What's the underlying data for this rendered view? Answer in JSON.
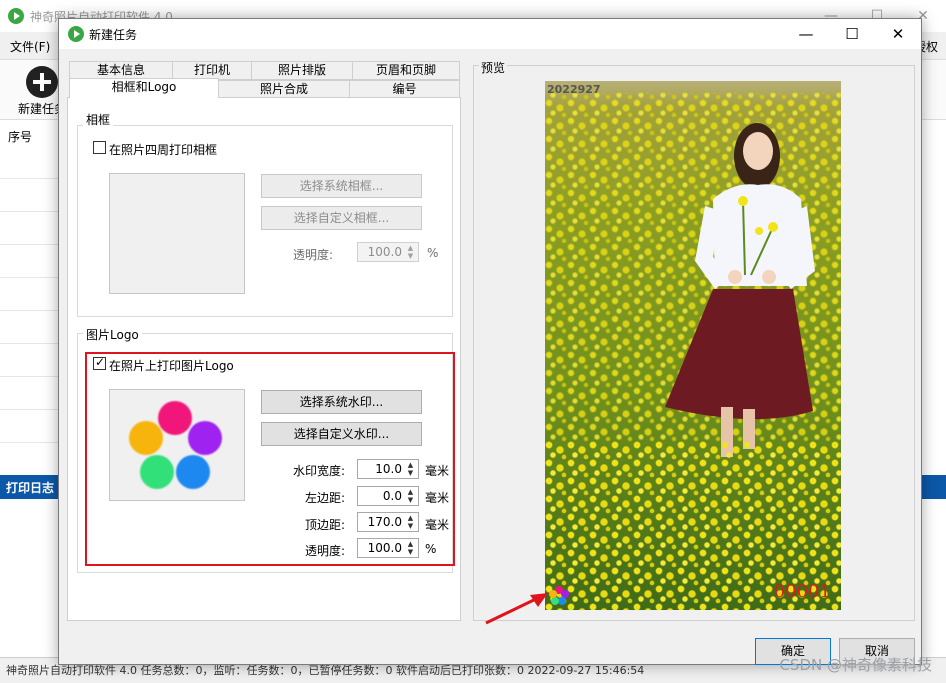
{
  "background_app": {
    "title": "神奇照片自动打印软件 4.0",
    "menu_file": "文件(F)",
    "menu_right": "授权",
    "toolbar_new_task": "新建任务",
    "table_header": "序号",
    "log_header": "打印日志",
    "statusbar": "神奇照片自动打印软件 4.0   任务总数：0，监听：任务数：0，已暂停任务数：0   软件启动后已打印张数：0   2022-09-27 15:46:54",
    "watermark": "CSDN @神奇像素科技"
  },
  "dialog": {
    "title": "新建任务",
    "tabs_row1": [
      "基本信息",
      "打印机",
      "照片排版",
      "页眉和页脚"
    ],
    "tabs_row2": [
      "相框和Logo",
      "照片合成",
      "编号"
    ],
    "active_tab": "相框和Logo",
    "frame_group": {
      "title": "相框",
      "checkbox_label": "在照片四周打印相框",
      "checked": false,
      "btn_system_frame": "选择系统相框...",
      "btn_custom_frame": "选择自定义相框...",
      "opacity_label": "透明度:",
      "opacity_value": "100.0",
      "opacity_unit": "%"
    },
    "logo_group": {
      "title": "图片Logo",
      "checkbox_label": "在照片上打印图片Logo",
      "checked": true,
      "btn_system_watermark": "选择系统水印...",
      "btn_custom_watermark": "选择自定义水印...",
      "fields": [
        {
          "label": "水印宽度:",
          "value": "10.0",
          "unit": "毫米"
        },
        {
          "label": "左边距:",
          "value": "0.0",
          "unit": "毫米"
        },
        {
          "label": "顶边距:",
          "value": "170.0",
          "unit": "毫米"
        },
        {
          "label": "透明度:",
          "value": "100.0",
          "unit": "%"
        }
      ],
      "logo_colors": [
        "#f0157a",
        "#a020f0",
        "#1e88f0",
        "#33e07a",
        "#f6b40c"
      ]
    },
    "preview": {
      "title": "预览",
      "date_stamp": "2022927",
      "number_stamp": "00001"
    },
    "ok_button": "确定",
    "cancel_button": "取消"
  },
  "colors": {
    "highlight_border": "#e0141e",
    "log_header_bg": "#0b58a8",
    "annotation_arrow": "#e0141e"
  }
}
